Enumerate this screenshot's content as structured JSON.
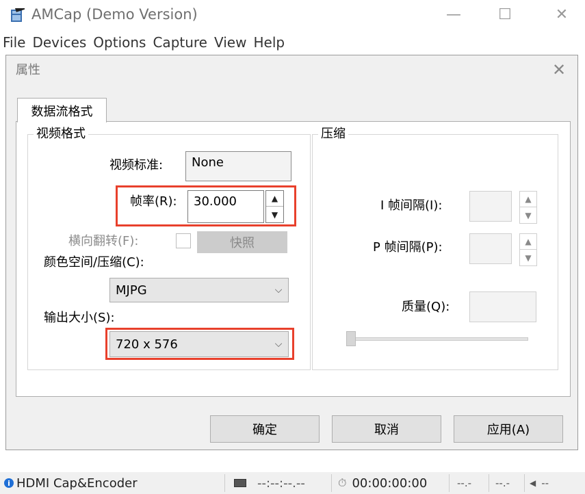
{
  "window": {
    "title": "AMCap (Demo Version)",
    "minimize_glyph": "—",
    "maximize_glyph": "☐",
    "close_glyph": "✕"
  },
  "menu": [
    "File",
    "Devices",
    "Options",
    "Capture",
    "View",
    "Help"
  ],
  "dialog": {
    "title": "属性",
    "close_glyph": "✕",
    "tab": "数据流格式",
    "video_group": {
      "title": "视频格式",
      "standard_label": "视频标准:",
      "standard_value": "None",
      "framerate_label": "帧率(R):",
      "framerate_value": "30.000",
      "flip_label": "横向翻转(F):",
      "snapshot_button": "快照",
      "colorspace_label": "颜色空间/压缩(C):",
      "colorspace_value": "MJPG",
      "output_size_label": "输出大小(S):",
      "output_size_value": "720 x 576"
    },
    "compression_group": {
      "title": "压缩",
      "i_frame_label": "I 帧间隔(I):",
      "p_frame_label": "P 帧间隔(P):",
      "quality_label": "质量(Q):"
    },
    "buttons": {
      "ok": "确定",
      "cancel": "取消",
      "apply": "应用(A)"
    }
  },
  "statusbar": {
    "device": "HDMI Cap&Encoder",
    "timecode": "--:--:--.--",
    "elapsed": "00:00:00:00",
    "field1": "--.-",
    "field2": "--.-",
    "audio": "--"
  },
  "icons": {
    "spin_up": "▲",
    "spin_down": "▼",
    "dropdown": "⌵",
    "info": "i",
    "stopwatch": "⏱",
    "speaker": "◀"
  },
  "colors": {
    "highlight": "#e8402c",
    "info_icon": "#1f6fd6",
    "dialog_bg": "#f0f0f0",
    "disabled_text": "#8c8c8c"
  }
}
